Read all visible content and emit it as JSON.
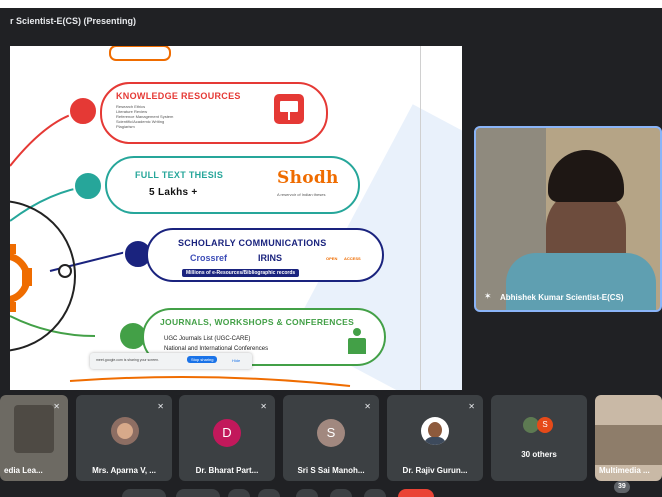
{
  "presenter_label": "r Scientist-E(CS) (Presenting)",
  "slide": {
    "knowledge": {
      "title": "KNOWLEDGE RESOURCES",
      "items": [
        "Research Ethics",
        "Literature Review",
        "Reference Management System",
        "Scientific/Academic Writing",
        "Plagiarism"
      ]
    },
    "thesis": {
      "title": "FULL TEXT THESIS",
      "count": "5 Lakhs +",
      "brand": "Shodh",
      "brand_tagline": "A reservoir of Indian theses"
    },
    "scholarly": {
      "title": "SCHOLARLY COMMUNICATIONS",
      "logos": [
        "Crossref",
        "IRINS",
        "OPEN",
        "ACCESS"
      ],
      "caption": "Millions of e-Resources/Bibliographic records"
    },
    "journals": {
      "title": "JOURNALS, WORKSHOPS & CONFERENCES",
      "items": [
        "UGC Journals List (UGC-CARE)",
        "National and International Conferences"
      ]
    },
    "share_notice": {
      "text": "meet.google.com is sharing your screen.",
      "stop_label": "Stop sharing",
      "hide_label": "Hide"
    }
  },
  "speaker": {
    "name": "Abhishek Kumar Scientist-E(CS)"
  },
  "participants": [
    {
      "name": "edia Lea...",
      "avatar": "photo"
    },
    {
      "name": "Mrs. Aparna V, ...",
      "avatar": "photo"
    },
    {
      "name": "Dr. Bharat Part...",
      "avatar": "D",
      "color": "#c2185b"
    },
    {
      "name": "Sri S Sai Manoh...",
      "avatar": "S",
      "color": "#a1887f"
    },
    {
      "name": "Dr. Rajiv Gurun...",
      "avatar": "photo"
    },
    {
      "name": "30 others",
      "avatar": "S",
      "color": "#e64a19"
    },
    {
      "name": "Multimedia ...",
      "avatar": "photo"
    }
  ],
  "participant_count": "39",
  "colors": {
    "knowledge": "#e53935",
    "thesis": "#26a69a",
    "scholarly": "#1a237e",
    "journals": "#43a047",
    "accent": "#ef6c00"
  }
}
